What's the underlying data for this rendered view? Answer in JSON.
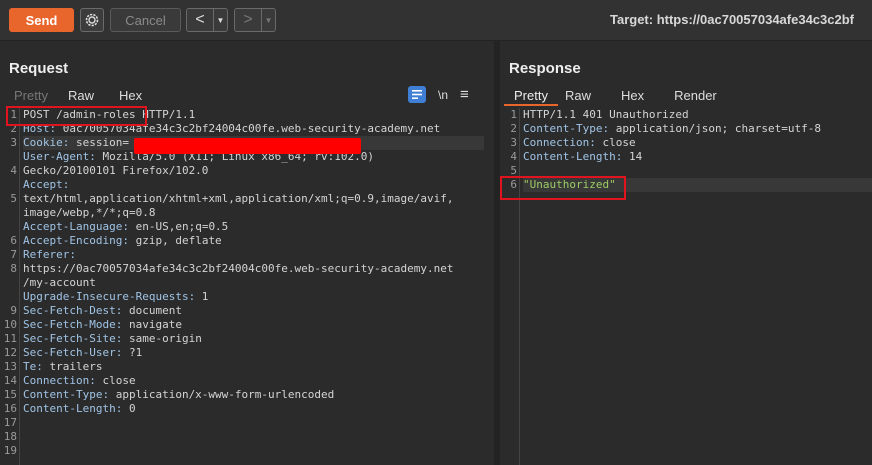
{
  "toolbar": {
    "send_label": "Send",
    "cancel_label": "Cancel",
    "back_glyph": "<",
    "forward_glyph": ">",
    "dropdown_glyph": "▼",
    "target_text": "Target: https://0ac70057034afe34c3c2bf"
  },
  "request": {
    "title": "Request",
    "tabs": [
      "Pretty",
      "Raw",
      "Hex"
    ],
    "newline_label": "\\n",
    "menu_glyph": "≡",
    "line_numbers": [
      "1",
      "2",
      "3",
      "",
      "4",
      "",
      "5",
      "",
      "",
      "6",
      "7",
      "8",
      "",
      "",
      "9",
      "10",
      "11",
      "12",
      "13",
      "14",
      "15",
      "16",
      "17",
      "18",
      "19"
    ],
    "lines": [
      {
        "k": "POST /admin-roles HTTP/1.1",
        "v": ""
      },
      {
        "k": "Host:",
        "v": " 0ac70057034afe34c3c2bf24004c00fe.web-security-academy.net"
      },
      {
        "k": "Cookie:",
        "v": " session="
      },
      {
        "k": "User-Agent:",
        "v": " Mozilla/5.0 (X11; Linux x86_64; rv:102.0)"
      },
      {
        "k": "",
        "v": "Gecko/20100101 Firefox/102.0"
      },
      {
        "k": "Accept:",
        "v": ""
      },
      {
        "k": "",
        "v": "text/html,application/xhtml+xml,application/xml;q=0.9,image/avif,"
      },
      {
        "k": "",
        "v": "image/webp,*/*;q=0.8"
      },
      {
        "k": "Accept-Language:",
        "v": " en-US,en;q=0.5"
      },
      {
        "k": "Accept-Encoding:",
        "v": " gzip, deflate"
      },
      {
        "k": "Referer:",
        "v": ""
      },
      {
        "k": "",
        "v": "https://0ac70057034afe34c3c2bf24004c00fe.web-security-academy.net"
      },
      {
        "k": "",
        "v": "/my-account"
      },
      {
        "k": "Upgrade-Insecure-Requests:",
        "v": " 1"
      },
      {
        "k": "Sec-Fetch-Dest:",
        "v": " document"
      },
      {
        "k": "Sec-Fetch-Mode:",
        "v": " navigate"
      },
      {
        "k": "Sec-Fetch-Site:",
        "v": " same-origin"
      },
      {
        "k": "Sec-Fetch-User:",
        "v": " ?1"
      },
      {
        "k": "Te:",
        "v": " trailers"
      },
      {
        "k": "Connection:",
        "v": " close"
      },
      {
        "k": "Content-Type:",
        "v": " application/x-www-form-urlencoded"
      },
      {
        "k": "Content-Length:",
        "v": " 0"
      },
      {
        "k": "",
        "v": ""
      },
      {
        "k": "",
        "v": ""
      }
    ]
  },
  "response": {
    "title": "Response",
    "tabs": [
      "Pretty",
      "Raw",
      "Hex",
      "Render"
    ],
    "line_numbers": [
      "1",
      "2",
      "3",
      "4",
      "5",
      "6"
    ],
    "lines": [
      {
        "k": "HTTP/1.1 401 Unauthorized",
        "v": ""
      },
      {
        "k": "Content-Type:",
        "v": " application/json; charset=utf-8"
      },
      {
        "k": "Connection:",
        "v": " close"
      },
      {
        "k": "Content-Length:",
        "v": " 14"
      },
      {
        "k": "",
        "v": ""
      },
      {
        "k": "",
        "v": "\"Unauthorized\""
      }
    ]
  },
  "colors": {
    "accent": "#e8652c",
    "highlight": "#e0141e"
  }
}
